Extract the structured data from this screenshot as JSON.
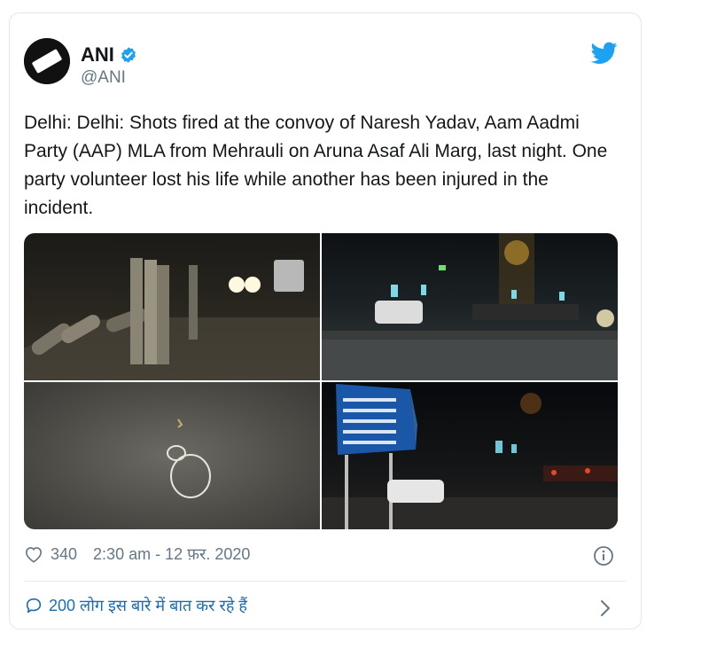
{
  "tweet": {
    "author_name": "ANI",
    "author_handle": "@ANI",
    "avatar_text": "ANI",
    "text": "Delhi: Delhi: Shots fired at the convoy of Naresh Yadav, Aam Aadmi Party (AAP) MLA from Mehrauli on Aruna Asaf Ali Marg, last night. One party volunteer lost his life while another has been injured in the incident.",
    "likes": "340",
    "timestamp": "2:30 am - 12 फ़र. 2020",
    "conversation_label": "200 लोग इस बारे में बात कर रहे हैं"
  },
  "icons": {
    "verified": "verified-badge-icon",
    "brand": "twitter-bird-icon",
    "like": "heart-icon",
    "info": "info-icon",
    "reply": "speech-bubble-icon",
    "more": "chevron-right-icon"
  },
  "colors": {
    "brand_blue": "#1da1f2",
    "link_blue": "#1b6db4",
    "secondary_text": "#657786",
    "border": "#e1e8ed"
  }
}
